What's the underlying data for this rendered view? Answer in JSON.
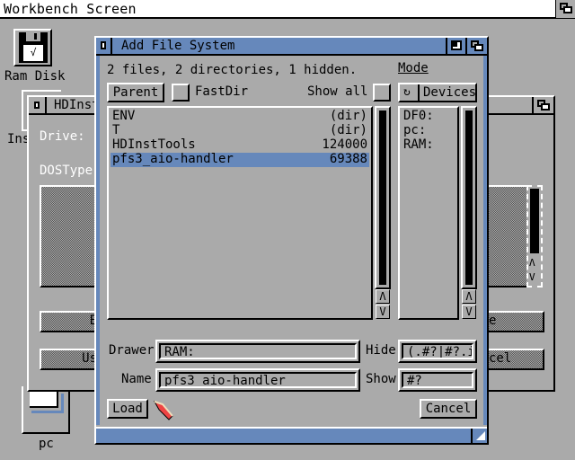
{
  "screen": {
    "title": "Workbench Screen"
  },
  "desktop": {
    "icons": [
      {
        "label": "Ram Disk",
        "icon": "ram-disk-icon",
        "glyph": "√"
      },
      {
        "label": "Ins",
        "icon": "drawer-icon"
      },
      {
        "label": "pc",
        "icon": "hard-disk-icon"
      }
    ]
  },
  "hdinst_window": {
    "title": "HDInst",
    "labels": {
      "drive": "Drive:",
      "dostype": "DOSType"
    },
    "buttons": [
      {
        "left_text": "E",
        "right_text": "e"
      },
      {
        "left_text": "Us",
        "right_text": "cel"
      }
    ]
  },
  "requester": {
    "title": "Add File System",
    "status": "2 files, 2 directories, 1 hidden.",
    "mode_label": "Mode",
    "parent_label": "Parent",
    "fastdir_label": "FastDir",
    "fastdir_checked": false,
    "show_all_label": "Show all",
    "show_all_checked": false,
    "devices_label": "Devices",
    "files": [
      {
        "name": "ENV",
        "size": "(dir)",
        "selected": false
      },
      {
        "name": "T",
        "size": "(dir)",
        "selected": false
      },
      {
        "name": "HDInstTools",
        "size": "124000",
        "selected": false
      },
      {
        "name": "pfs3_aio-handler",
        "size": "69388",
        "selected": true
      }
    ],
    "volumes": [
      "DF0:",
      "pc:",
      "RAM:"
    ],
    "drawer_label": "Drawer",
    "drawer_value": "RAM:",
    "name_label": "Name",
    "name_value": "pfs3_aio-handler",
    "hide_label": "Hide",
    "hide_value": "(.#?|#?.i",
    "show_label": "Show",
    "show_value": "#?",
    "load_label": "Load",
    "cancel_label": "Cancel",
    "scroll_up": "Λ",
    "scroll_down": "V"
  },
  "colors": {
    "background": "#aaaaaa",
    "accent": "#6688bb",
    "highlight": "#ffffff",
    "shadow": "#000000",
    "pointer": "#ee4444"
  }
}
